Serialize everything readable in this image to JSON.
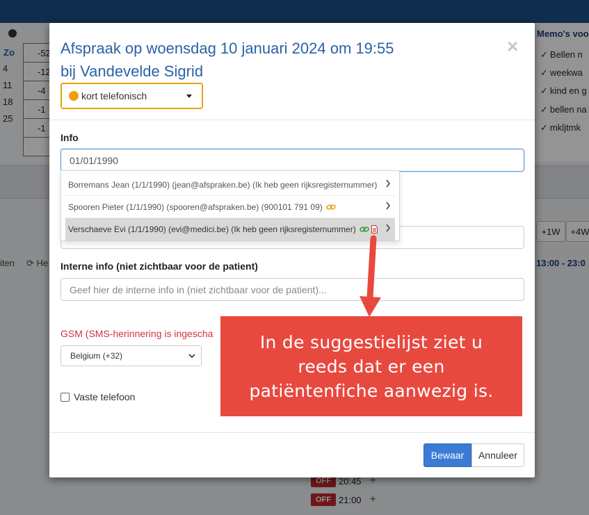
{
  "background": {
    "calendar_header": "Zo",
    "day_numbers": [
      "4",
      "11",
      "18",
      "25"
    ],
    "cal_cells": [
      "-52",
      "-12",
      "-4",
      "-1",
      "-1"
    ],
    "left_tools": [
      "iten",
      "He"
    ],
    "memo_title": "Memo's voo",
    "memo_items": [
      "Bellen n",
      "weekwa",
      "kind en g",
      "bellen na",
      "mkljtmk"
    ],
    "week_buttons": [
      "+1W",
      "+4W"
    ],
    "time_range": "13:00 - 23:0",
    "slots": [
      {
        "badge": "OFF",
        "time": "20:45"
      },
      {
        "badge": "OFF",
        "time": "21:00"
      }
    ]
  },
  "modal": {
    "title_line1": "Afspraak op woensdag 10 januari 2024 om 19:55",
    "title_line2": "bij Vandevelde Sigrid",
    "appointment_type": "kort telefonisch",
    "type_color": "#eea10c",
    "info_label": "Info",
    "info_value": "01/01/1990",
    "suggestions": [
      {
        "text": "Borremans Jean (1/1/1990) (jean@afspraken.be) (Ik heb geen rijksregisternummer)"
      },
      {
        "text": "Spooren Pieter (1/1/1990) (spooren@afspraken.be) (900101 791 09)"
      },
      {
        "text": "Verschaeve Evi (1/1/1990) (evi@medici.be) (Ik heb geen rijksregisternummer)"
      }
    ],
    "internal_label": "Interne info (niet zichtbaar voor de patient)",
    "internal_placeholder": "Geef hier de interne info in (niet zichtbaar voor de patient)...",
    "gsm_label": "GSM (SMS-herinnering is ingescha",
    "country": "Belgium (+32)",
    "landline_label": "Vaste telefoon",
    "save_label": "Bewaar",
    "cancel_label": "Annuleer",
    "close_glyph": "×"
  },
  "annotation": {
    "text": "In de suggestielijst ziet u reeds dat er een patiëntenfiche aanwezig is.",
    "color": "#e8493f"
  }
}
